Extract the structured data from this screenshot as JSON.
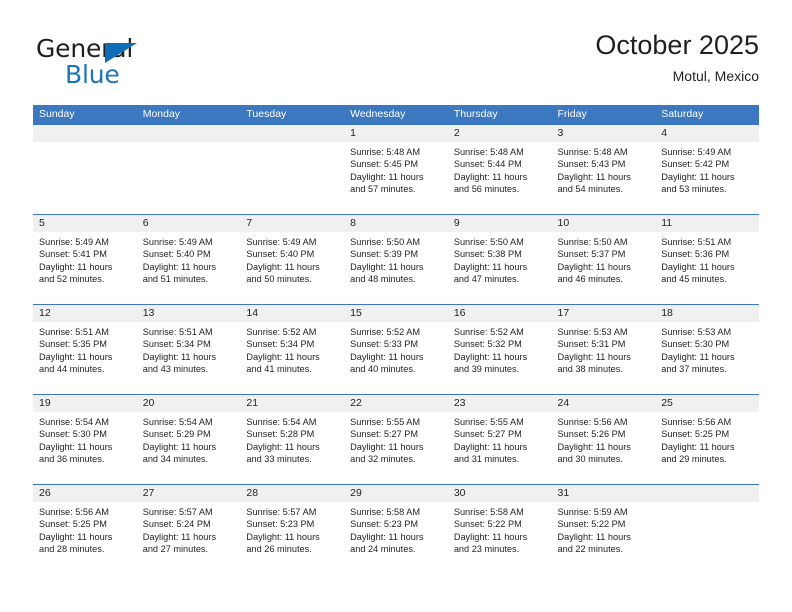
{
  "brand": {
    "name_top": "General",
    "name_bottom": "Blue",
    "triangle_icon": "triangle-icon",
    "color_dark": "#231f20",
    "color_blue": "#1b75bb"
  },
  "header": {
    "title": "October 2025",
    "subtitle": "Motul, Mexico"
  },
  "colors": {
    "header_blue": "#3b78bf",
    "day_band_gray": "#f0f0f0",
    "text": "#231f20"
  },
  "calendar": {
    "weekday_headers": [
      "Sunday",
      "Monday",
      "Tuesday",
      "Wednesday",
      "Thursday",
      "Friday",
      "Saturday"
    ],
    "labels": {
      "sunrise": "Sunrise:",
      "sunset": "Sunset:",
      "daylight": "Daylight:"
    },
    "weeks": [
      [
        {
          "day": "",
          "empty": true
        },
        {
          "day": "",
          "empty": true
        },
        {
          "day": "",
          "empty": true
        },
        {
          "day": "1",
          "sunrise": "Sunrise: 5:48 AM",
          "sunset": "Sunset: 5:45 PM",
          "daylight1": "Daylight: 11 hours",
          "daylight2": "and 57 minutes."
        },
        {
          "day": "2",
          "sunrise": "Sunrise: 5:48 AM",
          "sunset": "Sunset: 5:44 PM",
          "daylight1": "Daylight: 11 hours",
          "daylight2": "and 56 minutes."
        },
        {
          "day": "3",
          "sunrise": "Sunrise: 5:48 AM",
          "sunset": "Sunset: 5:43 PM",
          "daylight1": "Daylight: 11 hours",
          "daylight2": "and 54 minutes."
        },
        {
          "day": "4",
          "sunrise": "Sunrise: 5:49 AM",
          "sunset": "Sunset: 5:42 PM",
          "daylight1": "Daylight: 11 hours",
          "daylight2": "and 53 minutes."
        }
      ],
      [
        {
          "day": "5",
          "sunrise": "Sunrise: 5:49 AM",
          "sunset": "Sunset: 5:41 PM",
          "daylight1": "Daylight: 11 hours",
          "daylight2": "and 52 minutes."
        },
        {
          "day": "6",
          "sunrise": "Sunrise: 5:49 AM",
          "sunset": "Sunset: 5:40 PM",
          "daylight1": "Daylight: 11 hours",
          "daylight2": "and 51 minutes."
        },
        {
          "day": "7",
          "sunrise": "Sunrise: 5:49 AM",
          "sunset": "Sunset: 5:40 PM",
          "daylight1": "Daylight: 11 hours",
          "daylight2": "and 50 minutes."
        },
        {
          "day": "8",
          "sunrise": "Sunrise: 5:50 AM",
          "sunset": "Sunset: 5:39 PM",
          "daylight1": "Daylight: 11 hours",
          "daylight2": "and 48 minutes."
        },
        {
          "day": "9",
          "sunrise": "Sunrise: 5:50 AM",
          "sunset": "Sunset: 5:38 PM",
          "daylight1": "Daylight: 11 hours",
          "daylight2": "and 47 minutes."
        },
        {
          "day": "10",
          "sunrise": "Sunrise: 5:50 AM",
          "sunset": "Sunset: 5:37 PM",
          "daylight1": "Daylight: 11 hours",
          "daylight2": "and 46 minutes."
        },
        {
          "day": "11",
          "sunrise": "Sunrise: 5:51 AM",
          "sunset": "Sunset: 5:36 PM",
          "daylight1": "Daylight: 11 hours",
          "daylight2": "and 45 minutes."
        }
      ],
      [
        {
          "day": "12",
          "sunrise": "Sunrise: 5:51 AM",
          "sunset": "Sunset: 5:35 PM",
          "daylight1": "Daylight: 11 hours",
          "daylight2": "and 44 minutes."
        },
        {
          "day": "13",
          "sunrise": "Sunrise: 5:51 AM",
          "sunset": "Sunset: 5:34 PM",
          "daylight1": "Daylight: 11 hours",
          "daylight2": "and 43 minutes."
        },
        {
          "day": "14",
          "sunrise": "Sunrise: 5:52 AM",
          "sunset": "Sunset: 5:34 PM",
          "daylight1": "Daylight: 11 hours",
          "daylight2": "and 41 minutes."
        },
        {
          "day": "15",
          "sunrise": "Sunrise: 5:52 AM",
          "sunset": "Sunset: 5:33 PM",
          "daylight1": "Daylight: 11 hours",
          "daylight2": "and 40 minutes."
        },
        {
          "day": "16",
          "sunrise": "Sunrise: 5:52 AM",
          "sunset": "Sunset: 5:32 PM",
          "daylight1": "Daylight: 11 hours",
          "daylight2": "and 39 minutes."
        },
        {
          "day": "17",
          "sunrise": "Sunrise: 5:53 AM",
          "sunset": "Sunset: 5:31 PM",
          "daylight1": "Daylight: 11 hours",
          "daylight2": "and 38 minutes."
        },
        {
          "day": "18",
          "sunrise": "Sunrise: 5:53 AM",
          "sunset": "Sunset: 5:30 PM",
          "daylight1": "Daylight: 11 hours",
          "daylight2": "and 37 minutes."
        }
      ],
      [
        {
          "day": "19",
          "sunrise": "Sunrise: 5:54 AM",
          "sunset": "Sunset: 5:30 PM",
          "daylight1": "Daylight: 11 hours",
          "daylight2": "and 36 minutes."
        },
        {
          "day": "20",
          "sunrise": "Sunrise: 5:54 AM",
          "sunset": "Sunset: 5:29 PM",
          "daylight1": "Daylight: 11 hours",
          "daylight2": "and 34 minutes."
        },
        {
          "day": "21",
          "sunrise": "Sunrise: 5:54 AM",
          "sunset": "Sunset: 5:28 PM",
          "daylight1": "Daylight: 11 hours",
          "daylight2": "and 33 minutes."
        },
        {
          "day": "22",
          "sunrise": "Sunrise: 5:55 AM",
          "sunset": "Sunset: 5:27 PM",
          "daylight1": "Daylight: 11 hours",
          "daylight2": "and 32 minutes."
        },
        {
          "day": "23",
          "sunrise": "Sunrise: 5:55 AM",
          "sunset": "Sunset: 5:27 PM",
          "daylight1": "Daylight: 11 hours",
          "daylight2": "and 31 minutes."
        },
        {
          "day": "24",
          "sunrise": "Sunrise: 5:56 AM",
          "sunset": "Sunset: 5:26 PM",
          "daylight1": "Daylight: 11 hours",
          "daylight2": "and 30 minutes."
        },
        {
          "day": "25",
          "sunrise": "Sunrise: 5:56 AM",
          "sunset": "Sunset: 5:25 PM",
          "daylight1": "Daylight: 11 hours",
          "daylight2": "and 29 minutes."
        }
      ],
      [
        {
          "day": "26",
          "sunrise": "Sunrise: 5:56 AM",
          "sunset": "Sunset: 5:25 PM",
          "daylight1": "Daylight: 11 hours",
          "daylight2": "and 28 minutes."
        },
        {
          "day": "27",
          "sunrise": "Sunrise: 5:57 AM",
          "sunset": "Sunset: 5:24 PM",
          "daylight1": "Daylight: 11 hours",
          "daylight2": "and 27 minutes."
        },
        {
          "day": "28",
          "sunrise": "Sunrise: 5:57 AM",
          "sunset": "Sunset: 5:23 PM",
          "daylight1": "Daylight: 11 hours",
          "daylight2": "and 26 minutes."
        },
        {
          "day": "29",
          "sunrise": "Sunrise: 5:58 AM",
          "sunset": "Sunset: 5:23 PM",
          "daylight1": "Daylight: 11 hours",
          "daylight2": "and 24 minutes."
        },
        {
          "day": "30",
          "sunrise": "Sunrise: 5:58 AM",
          "sunset": "Sunset: 5:22 PM",
          "daylight1": "Daylight: 11 hours",
          "daylight2": "and 23 minutes."
        },
        {
          "day": "31",
          "sunrise": "Sunrise: 5:59 AM",
          "sunset": "Sunset: 5:22 PM",
          "daylight1": "Daylight: 11 hours",
          "daylight2": "and 22 minutes."
        },
        {
          "day": "",
          "empty": true
        }
      ]
    ]
  }
}
